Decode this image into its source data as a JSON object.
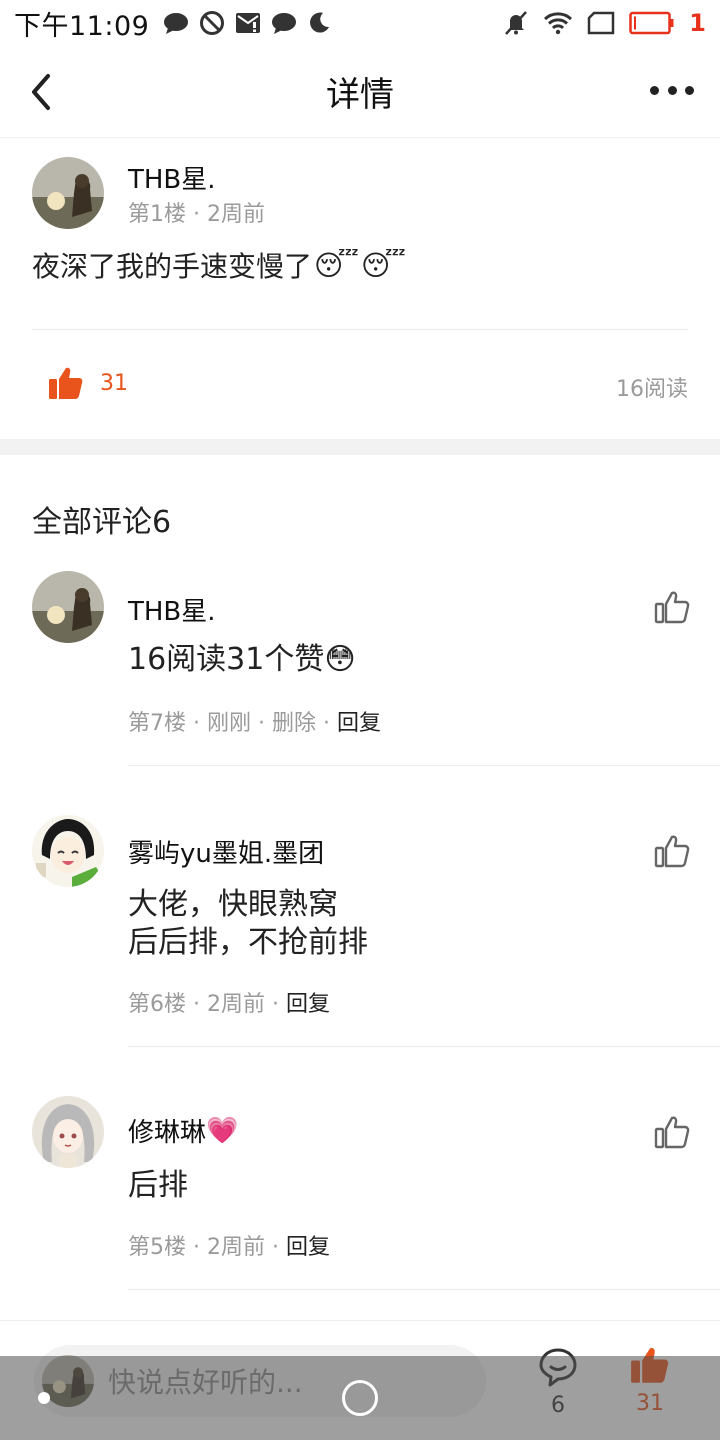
{
  "status_bar": {
    "time": "下午11:09",
    "battery_level": "1"
  },
  "nav": {
    "title": "详情"
  },
  "post": {
    "author": "THB星.",
    "floor": "第1楼",
    "time": "2周前",
    "text": "夜深了我的手速变慢了",
    "emojis": [
      "😴",
      "😴"
    ],
    "like_count": "31",
    "reads": "16阅读"
  },
  "comments_heading": "全部评论6",
  "comments": [
    {
      "author": "THB星.",
      "author_emoji": "",
      "text_lines": [
        "16阅读31个赞😳"
      ],
      "floor": "第7楼",
      "time": "刚刚",
      "delete_label": "删除",
      "reply_label": "回复"
    },
    {
      "author": "雾屿yu墨姐.墨团",
      "author_emoji": "",
      "text_lines": [
        "大佬，快眼熟窝",
        "后后排，不抢前排"
      ],
      "floor": "第6楼",
      "time": "2周前",
      "delete_label": "",
      "reply_label": "回复"
    },
    {
      "author": "修琳琳",
      "author_emoji": "💗",
      "text_lines": [
        "后排"
      ],
      "floor": "第5楼",
      "time": "2周前",
      "delete_label": "",
      "reply_label": "回复"
    }
  ],
  "bottom_bar": {
    "placeholder": "快说点好听的...",
    "comment_count": "6",
    "like_count": "31"
  },
  "colors": {
    "accent": "#e8541c",
    "battery_low": "#e8311a",
    "meta_gray": "#9a9a9a"
  }
}
